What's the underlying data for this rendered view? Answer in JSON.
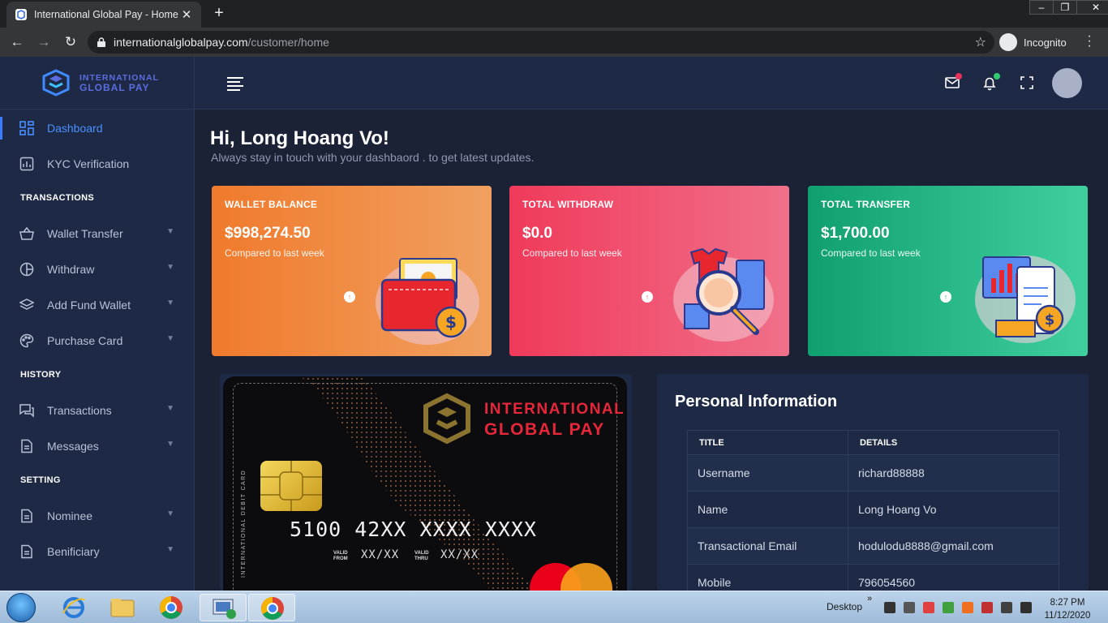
{
  "browser": {
    "tab_title": "International Global Pay - Home",
    "url_host": "internationalglobalpay.com",
    "url_path": "/customer/home",
    "incognito_label": "Incognito"
  },
  "brand": {
    "line1": "INTERNATIONAL",
    "line2": "GLOBAL PAY"
  },
  "sidebar": {
    "items": [
      {
        "label": "Dashboard",
        "icon": "dashboard-icon",
        "active": true
      },
      {
        "label": "KYC Verification",
        "icon": "chart-icon"
      }
    ],
    "sections": [
      {
        "title": "TRANSACTIONS",
        "items": [
          {
            "label": "Wallet Transfer",
            "icon": "basket-icon"
          },
          {
            "label": "Withdraw",
            "icon": "pie-icon"
          },
          {
            "label": "Add Fund Wallet",
            "icon": "layers-icon"
          },
          {
            "label": "Purchase Card",
            "icon": "palette-icon"
          }
        ]
      },
      {
        "title": "HISTORY",
        "items": [
          {
            "label": "Transactions",
            "icon": "chat-icon"
          },
          {
            "label": "Messages",
            "icon": "document-icon"
          }
        ]
      },
      {
        "title": "SETTING",
        "items": [
          {
            "label": "Nominee",
            "icon": "document-icon"
          },
          {
            "label": "Benificiary",
            "icon": "document-icon"
          }
        ]
      }
    ]
  },
  "greeting": {
    "title": "Hi, Long Hoang Vo!",
    "subtitle": "Always stay in touch with your dashbaord . to get latest updates."
  },
  "stats": [
    {
      "label": "WALLET BALANCE",
      "value": "$998,274.50",
      "compare": "Compared to last week"
    },
    {
      "label": "TOTAL WITHDRAW",
      "value": "$0.0",
      "compare": "Compared to last week"
    },
    {
      "label": "TOTAL TRANSFER",
      "value": "$1,700.00",
      "compare": "Compared to last week"
    }
  ],
  "debit_card": {
    "brand_line1": "INTERNATIONAL",
    "brand_line2": "GLOBAL PAY",
    "type_label": "INTERNATIONAL DEBIT CARD",
    "number": "5100 42XX XXXX XXXX",
    "valid_from_label_1": "VALID",
    "valid_from_label_2": "FROM",
    "valid_from": "XX/XX",
    "valid_thru_label_1": "VALID",
    "valid_thru_label_2": "THRU",
    "valid_thru": "XX/XX"
  },
  "personal_info": {
    "title": "Personal Information",
    "columns": [
      "TITLE",
      "DETAILS"
    ],
    "rows": [
      [
        "Username",
        "richard88888"
      ],
      [
        "Name",
        "Long Hoang Vo"
      ],
      [
        "Transactional Email",
        "hodulodu8888@gmail.com"
      ],
      [
        "Mobile",
        "796054560"
      ]
    ]
  },
  "taskbar": {
    "desktop_label": "Desktop",
    "time": "8:27 PM",
    "date": "11/12/2020"
  }
}
